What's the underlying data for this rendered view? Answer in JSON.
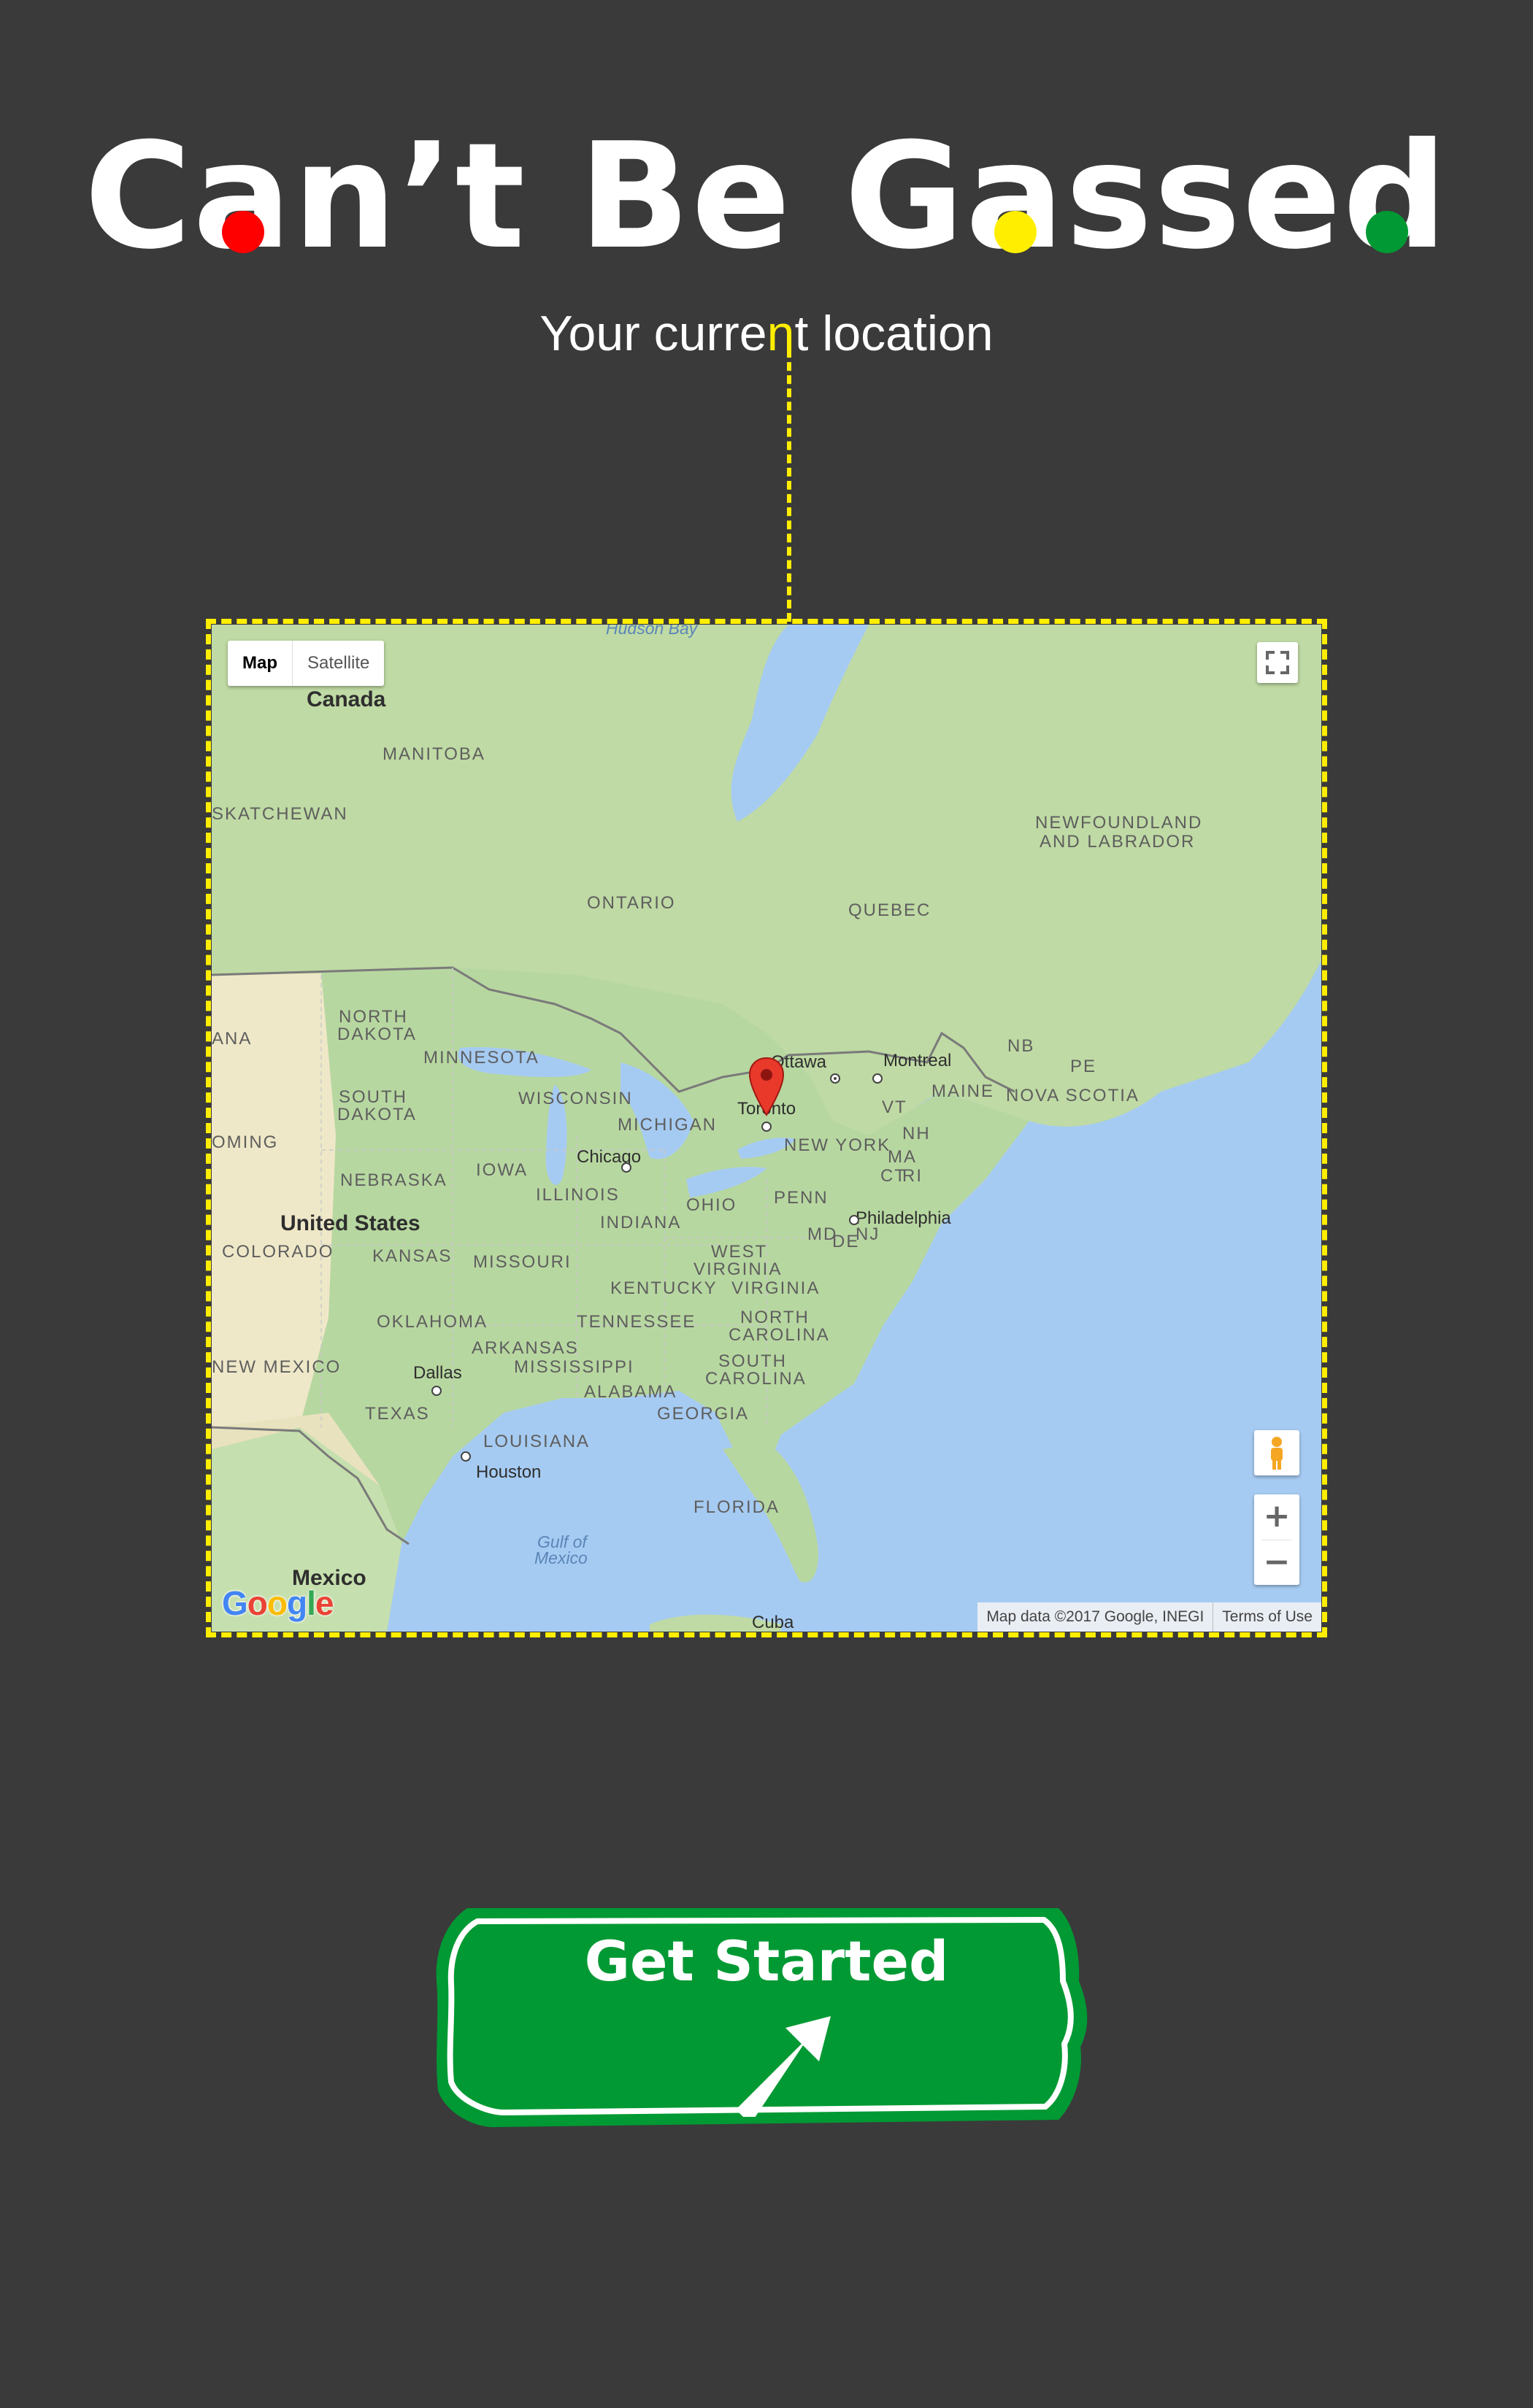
{
  "header": {
    "title_parts": [
      "C",
      "a",
      "n’t Be G",
      "a",
      "sse",
      "d"
    ],
    "subtitle_before": "Your curre",
    "subtitle_highlight": "n",
    "subtitle_after": "t location"
  },
  "colors": {
    "background": "#3a3a3a",
    "accent_yellow": "#ffee00",
    "dot_red": "#ff0000",
    "dot_yellow": "#ffee00",
    "dot_green": "#009933",
    "button_green": "#009933"
  },
  "map": {
    "type_control": {
      "map_label": "Map",
      "satellite_label": "Satellite",
      "active": "Map"
    },
    "labels": {
      "hudson_bay": "Hudson Bay",
      "canada": "Canada",
      "manitoba": "MANITOBA",
      "saskatchewan": "SKATCHEWAN",
      "ontario": "ONTARIO",
      "quebec": "QUEBEC",
      "newfoundland": "NEWFOUNDLAND",
      "newfoundland2": "AND LABRADOR",
      "north_dakota1": "NORTH",
      "north_dakota2": "DAKOTA",
      "minnesota": "MINNESOTA",
      "south_dakota1": "SOUTH",
      "south_dakota2": "DAKOTA",
      "wyoming": "OMING",
      "montana": "ANA",
      "wisconsin": "WISCONSIN",
      "michigan": "MICHIGAN",
      "nebraska": "NEBRASKA",
      "iowa": "IOWA",
      "illinois": "ILLINOIS",
      "indiana": "INDIANA",
      "ohio": "OHIO",
      "penn": "PENN",
      "united_states": "United States",
      "colorado": "COLORADO",
      "kansas": "KANSAS",
      "missouri": "MISSOURI",
      "kentucky": "KENTUCKY",
      "west_virginia1": "WEST",
      "west_virginia2": "VIRGINIA",
      "virginia": "VIRGINIA",
      "oklahoma": "OKLAHOMA",
      "tennessee": "TENNESSEE",
      "north_carolina1": "NORTH",
      "north_carolina2": "CAROLINA",
      "new_mexico": "NEW MEXICO",
      "arkansas": "ARKANSAS",
      "mississippi": "MISSISSIPPI",
      "alabama": "ALABAMA",
      "south_carolina1": "SOUTH",
      "south_carolina2": "CAROLINA",
      "georgia": "GEORGIA",
      "texas": "TEXAS",
      "louisiana": "LOUISIANA",
      "florida": "FLORIDA",
      "gulf1": "Gulf of",
      "gulf2": "Mexico",
      "mexico": "Mexico",
      "cuba": "Cuba",
      "new_york": "NEW YORK",
      "vt": "VT",
      "nh": "NH",
      "ma": "MA",
      "ct": "CT",
      "ri": "RI",
      "md": "MD",
      "de": "DE",
      "nj": "NJ",
      "maine": "MAINE",
      "nb": "NB",
      "pe": "PE",
      "nova_scotia": "NOVA SCOTIA",
      "ottawa": "Ottawa",
      "montreal": "Montreal",
      "toronto": "Toronto",
      "chicago": "Chicago",
      "philadelphia": "Philadelphia",
      "dallas": "Dallas",
      "houston": "Houston"
    },
    "zoom_in": "+",
    "zoom_out": "−",
    "logo": "Google",
    "attribution": "Map data ©2017 Google, INEGI",
    "terms": "Terms of Use",
    "marker_location": "Toronto"
  },
  "cta": {
    "label": "Get Started",
    "icon": "arrow-up-right-icon"
  }
}
